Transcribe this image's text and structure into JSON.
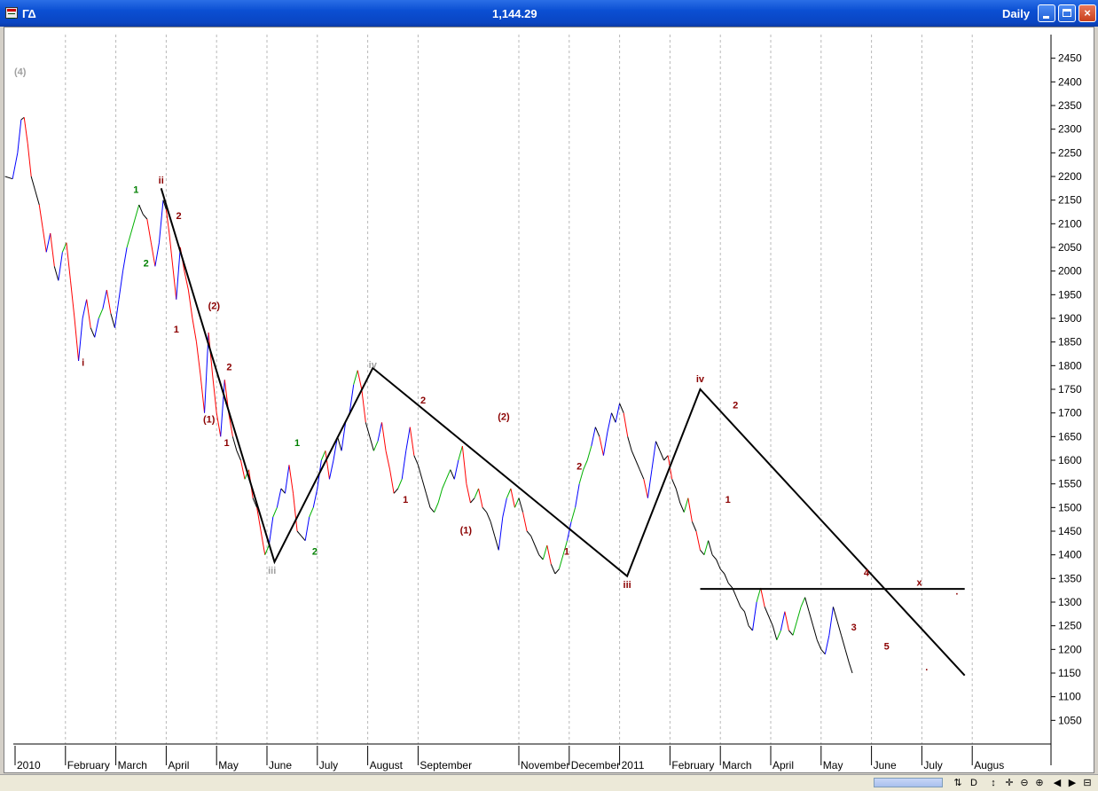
{
  "window": {
    "symbol": "ΓΔ",
    "last_value": "1,144.29",
    "period": "Daily",
    "minimize_label": "",
    "maximize_label": "",
    "close_label": "×"
  },
  "colors": {
    "up": "#0000ff",
    "down": "#ff0000",
    "neutral": "#000000",
    "correction": "#00b000",
    "label_dark": "#8b0000",
    "label_green": "#008000",
    "label_gray": "#a0a0a0"
  },
  "chart_data": {
    "type": "line",
    "title": "",
    "xlabel": "",
    "ylabel": "",
    "ylim": [
      1000,
      2500
    ],
    "y_ticks": [
      1050,
      1100,
      1150,
      1200,
      1250,
      1300,
      1350,
      1400,
      1450,
      1500,
      1550,
      1600,
      1650,
      1700,
      1750,
      1800,
      1850,
      1900,
      1950,
      2000,
      2050,
      2100,
      2150,
      2200,
      2250,
      2300,
      2350,
      2400,
      2450
    ],
    "x_ticks": [
      {
        "label": "2010",
        "x": 0.0
      },
      {
        "label": "February",
        "x": 1.0
      },
      {
        "label": "March",
        "x": 2.0
      },
      {
        "label": "April",
        "x": 3.0
      },
      {
        "label": "May",
        "x": 4.0
      },
      {
        "label": "June",
        "x": 5.0
      },
      {
        "label": "July",
        "x": 6.0
      },
      {
        "label": "August",
        "x": 7.0
      },
      {
        "label": "September",
        "x": 8.0
      },
      {
        "label": "November",
        "x": 10.0
      },
      {
        "label": "December",
        "x": 11.0
      },
      {
        "label": "2011",
        "x": 12.0
      },
      {
        "label": "February",
        "x": 13.0
      },
      {
        "label": "March",
        "x": 14.0
      },
      {
        "label": "April",
        "x": 15.0
      },
      {
        "label": "May",
        "x": 16.0
      },
      {
        "label": "June",
        "x": 17.0
      },
      {
        "label": "July",
        "x": 18.0
      },
      {
        "label": "Augus",
        "x": 19.0
      }
    ],
    "grid": "vertical",
    "series": [
      {
        "points": [
          [
            -0.2,
            2200
          ],
          [
            -0.05,
            2195
          ],
          [
            0.05,
            2250
          ],
          [
            0.12,
            2320
          ],
          [
            0.18,
            2325
          ],
          [
            0.25,
            2270
          ],
          [
            0.32,
            2200
          ],
          [
            0.4,
            2170
          ],
          [
            0.48,
            2140
          ],
          [
            0.55,
            2090
          ],
          [
            0.62,
            2040
          ],
          [
            0.7,
            2080
          ],
          [
            0.78,
            2010
          ],
          [
            0.86,
            1980
          ],
          [
            0.94,
            2040
          ],
          [
            1.02,
            2060
          ],
          [
            1.1,
            1980
          ],
          [
            1.18,
            1900
          ],
          [
            1.26,
            1810
          ],
          [
            1.34,
            1900
          ],
          [
            1.42,
            1940
          ],
          [
            1.5,
            1880
          ],
          [
            1.58,
            1860
          ],
          [
            1.66,
            1900
          ],
          [
            1.74,
            1920
          ],
          [
            1.82,
            1960
          ],
          [
            1.9,
            1910
          ],
          [
            1.98,
            1880
          ],
          [
            2.06,
            1940
          ],
          [
            2.14,
            2000
          ],
          [
            2.22,
            2050
          ],
          [
            2.3,
            2080
          ],
          [
            2.38,
            2110
          ],
          [
            2.46,
            2140
          ],
          [
            2.54,
            2120
          ],
          [
            2.62,
            2110
          ],
          [
            2.7,
            2060
          ],
          [
            2.78,
            2010
          ],
          [
            2.86,
            2060
          ],
          [
            2.94,
            2150
          ],
          [
            3.0,
            2130
          ],
          [
            3.06,
            2080
          ],
          [
            3.12,
            2020
          ],
          [
            3.2,
            1940
          ],
          [
            3.28,
            2050
          ],
          [
            3.36,
            2000
          ],
          [
            3.44,
            1960
          ],
          [
            3.52,
            1900
          ],
          [
            3.6,
            1850
          ],
          [
            3.68,
            1780
          ],
          [
            3.76,
            1700
          ],
          [
            3.84,
            1870
          ],
          [
            3.92,
            1780
          ],
          [
            4.0,
            1700
          ],
          [
            4.08,
            1650
          ],
          [
            4.16,
            1770
          ],
          [
            4.24,
            1700
          ],
          [
            4.32,
            1650
          ],
          [
            4.4,
            1620
          ],
          [
            4.48,
            1600
          ],
          [
            4.56,
            1560
          ],
          [
            4.64,
            1580
          ],
          [
            4.72,
            1520
          ],
          [
            4.8,
            1500
          ],
          [
            4.88,
            1450
          ],
          [
            4.96,
            1400
          ],
          [
            5.04,
            1420
          ],
          [
            5.12,
            1480
          ],
          [
            5.2,
            1500
          ],
          [
            5.28,
            1540
          ],
          [
            5.36,
            1530
          ],
          [
            5.44,
            1590
          ],
          [
            5.52,
            1530
          ],
          [
            5.6,
            1450
          ],
          [
            5.68,
            1440
          ],
          [
            5.76,
            1430
          ],
          [
            5.84,
            1480
          ],
          [
            5.92,
            1500
          ],
          [
            6.0,
            1540
          ],
          [
            6.08,
            1600
          ],
          [
            6.16,
            1620
          ],
          [
            6.24,
            1560
          ],
          [
            6.32,
            1600
          ],
          [
            6.4,
            1650
          ],
          [
            6.48,
            1620
          ],
          [
            6.56,
            1680
          ],
          [
            6.64,
            1700
          ],
          [
            6.72,
            1760
          ],
          [
            6.8,
            1790
          ],
          [
            6.88,
            1750
          ],
          [
            6.96,
            1680
          ],
          [
            7.04,
            1650
          ],
          [
            7.12,
            1620
          ],
          [
            7.2,
            1640
          ],
          [
            7.28,
            1680
          ],
          [
            7.36,
            1620
          ],
          [
            7.44,
            1580
          ],
          [
            7.52,
            1530
          ],
          [
            7.6,
            1540
          ],
          [
            7.68,
            1560
          ],
          [
            7.76,
            1620
          ],
          [
            7.84,
            1670
          ],
          [
            7.92,
            1610
          ],
          [
            8.0,
            1590
          ],
          [
            8.08,
            1560
          ],
          [
            8.16,
            1530
          ],
          [
            8.24,
            1500
          ],
          [
            8.32,
            1490
          ],
          [
            8.4,
            1510
          ],
          [
            8.48,
            1540
          ],
          [
            8.56,
            1560
          ],
          [
            8.64,
            1580
          ],
          [
            8.72,
            1560
          ],
          [
            8.8,
            1600
          ],
          [
            8.88,
            1630
          ],
          [
            8.96,
            1550
          ],
          [
            9.04,
            1510
          ],
          [
            9.12,
            1520
          ],
          [
            9.2,
            1540
          ],
          [
            9.28,
            1500
          ],
          [
            9.36,
            1490
          ],
          [
            9.44,
            1470
          ],
          [
            9.52,
            1440
          ],
          [
            9.6,
            1410
          ],
          [
            9.68,
            1480
          ],
          [
            9.76,
            1520
          ],
          [
            9.84,
            1540
          ],
          [
            9.92,
            1500
          ],
          [
            10.0,
            1520
          ],
          [
            10.08,
            1490
          ],
          [
            10.16,
            1450
          ],
          [
            10.24,
            1440
          ],
          [
            10.32,
            1420
          ],
          [
            10.4,
            1400
          ],
          [
            10.48,
            1390
          ],
          [
            10.56,
            1420
          ],
          [
            10.64,
            1380
          ],
          [
            10.72,
            1360
          ],
          [
            10.8,
            1370
          ],
          [
            10.88,
            1400
          ],
          [
            10.96,
            1430
          ],
          [
            11.04,
            1470
          ],
          [
            11.12,
            1500
          ],
          [
            11.2,
            1550
          ],
          [
            11.28,
            1580
          ],
          [
            11.36,
            1600
          ],
          [
            11.44,
            1630
          ],
          [
            11.52,
            1670
          ],
          [
            11.6,
            1650
          ],
          [
            11.68,
            1610
          ],
          [
            11.76,
            1660
          ],
          [
            11.84,
            1700
          ],
          [
            11.92,
            1680
          ],
          [
            12.0,
            1720
          ],
          [
            12.08,
            1700
          ],
          [
            12.16,
            1650
          ],
          [
            12.24,
            1620
          ],
          [
            12.32,
            1600
          ],
          [
            12.4,
            1580
          ],
          [
            12.48,
            1560
          ],
          [
            12.56,
            1520
          ],
          [
            12.64,
            1580
          ],
          [
            12.72,
            1640
          ],
          [
            12.8,
            1620
          ],
          [
            12.88,
            1600
          ],
          [
            12.96,
            1610
          ],
          [
            13.04,
            1560
          ],
          [
            13.12,
            1540
          ],
          [
            13.2,
            1510
          ],
          [
            13.28,
            1490
          ],
          [
            13.36,
            1520
          ],
          [
            13.44,
            1470
          ],
          [
            13.52,
            1450
          ],
          [
            13.6,
            1410
          ],
          [
            13.68,
            1400
          ],
          [
            13.76,
            1430
          ],
          [
            13.84,
            1400
          ],
          [
            13.92,
            1390
          ],
          [
            14.0,
            1370
          ],
          [
            14.08,
            1360
          ],
          [
            14.16,
            1340
          ],
          [
            14.24,
            1330
          ],
          [
            14.32,
            1310
          ],
          [
            14.4,
            1290
          ],
          [
            14.48,
            1280
          ],
          [
            14.56,
            1250
          ],
          [
            14.64,
            1240
          ],
          [
            14.72,
            1300
          ],
          [
            14.8,
            1330
          ],
          [
            14.88,
            1290
          ],
          [
            14.96,
            1270
          ],
          [
            15.04,
            1250
          ],
          [
            15.12,
            1220
          ],
          [
            15.2,
            1240
          ],
          [
            15.28,
            1280
          ],
          [
            15.36,
            1240
          ],
          [
            15.44,
            1230
          ],
          [
            15.52,
            1260
          ],
          [
            15.6,
            1290
          ],
          [
            15.68,
            1310
          ],
          [
            15.76,
            1280
          ],
          [
            15.84,
            1250
          ],
          [
            15.92,
            1220
          ],
          [
            16.0,
            1200
          ],
          [
            16.08,
            1190
          ],
          [
            16.16,
            1230
          ],
          [
            16.24,
            1290
          ],
          [
            16.32,
            1260
          ],
          [
            16.4,
            1230
          ],
          [
            16.48,
            1200
          ],
          [
            16.56,
            1170
          ],
          [
            16.62,
            1150
          ]
        ]
      }
    ]
  },
  "annotations": [
    {
      "text": "(4)",
      "x": 0.1,
      "y": 2415,
      "color": "gray"
    },
    {
      "text": "ii",
      "x": 2.9,
      "y": 2185,
      "color": "dark"
    },
    {
      "text": "1",
      "x": 2.4,
      "y": 2165,
      "color": "green"
    },
    {
      "text": "2",
      "x": 3.25,
      "y": 2110,
      "color": "dark"
    },
    {
      "text": "2",
      "x": 2.6,
      "y": 2010,
      "color": "green"
    },
    {
      "text": "1",
      "x": 3.2,
      "y": 1870,
      "color": "dark"
    },
    {
      "text": "(2)",
      "x": 3.95,
      "y": 1920,
      "color": "dark"
    },
    {
      "text": "2",
      "x": 4.25,
      "y": 1790,
      "color": "dark"
    },
    {
      "text": "i",
      "x": 1.35,
      "y": 1800,
      "color": "dark"
    },
    {
      "text": "(1)",
      "x": 3.85,
      "y": 1680,
      "color": "dark"
    },
    {
      "text": "1",
      "x": 4.2,
      "y": 1630,
      "color": "dark"
    },
    {
      "text": "1",
      "x": 5.6,
      "y": 1630,
      "color": "green"
    },
    {
      "text": "2",
      "x": 5.95,
      "y": 1400,
      "color": "green"
    },
    {
      "text": "iii",
      "x": 5.1,
      "y": 1360,
      "color": "gray"
    },
    {
      "text": "iv",
      "x": 7.1,
      "y": 1795,
      "color": "gray"
    },
    {
      "text": "2",
      "x": 8.1,
      "y": 1720,
      "color": "dark"
    },
    {
      "text": "1",
      "x": 7.75,
      "y": 1510,
      "color": "dark"
    },
    {
      "text": "(2)",
      "x": 9.7,
      "y": 1685,
      "color": "dark"
    },
    {
      "text": "(1)",
      "x": 8.95,
      "y": 1445,
      "color": "dark"
    },
    {
      "text": "2",
      "x": 11.2,
      "y": 1580,
      "color": "dark"
    },
    {
      "text": "1",
      "x": 10.95,
      "y": 1400,
      "color": "dark"
    },
    {
      "text": "iii",
      "x": 12.15,
      "y": 1330,
      "color": "dark"
    },
    {
      "text": "iv",
      "x": 13.6,
      "y": 1765,
      "color": "dark"
    },
    {
      "text": "2",
      "x": 14.3,
      "y": 1710,
      "color": "dark"
    },
    {
      "text": "1",
      "x": 14.15,
      "y": 1510,
      "color": "dark"
    },
    {
      "text": "4",
      "x": 16.9,
      "y": 1355,
      "color": "dark"
    },
    {
      "text": "3",
      "x": 16.65,
      "y": 1240,
      "color": "dark"
    },
    {
      "text": "5",
      "x": 17.3,
      "y": 1200,
      "color": "dark"
    },
    {
      "text": "x",
      "x": 17.95,
      "y": 1335,
      "color": "dark"
    },
    {
      "text": "·",
      "x": 18.7,
      "y": 1310,
      "color": "dark"
    },
    {
      "text": "·",
      "x": 18.1,
      "y": 1150,
      "color": "dark"
    }
  ],
  "trendlines": [
    {
      "points": [
        [
          2.9,
          2175
        ],
        [
          5.15,
          1385
        ],
        [
          7.1,
          1795
        ],
        [
          12.15,
          1355
        ],
        [
          13.6,
          1750
        ],
        [
          18.85,
          1145
        ]
      ]
    },
    {
      "points": [
        [
          13.6,
          1328
        ],
        [
          18.85,
          1328
        ]
      ]
    }
  ]
}
